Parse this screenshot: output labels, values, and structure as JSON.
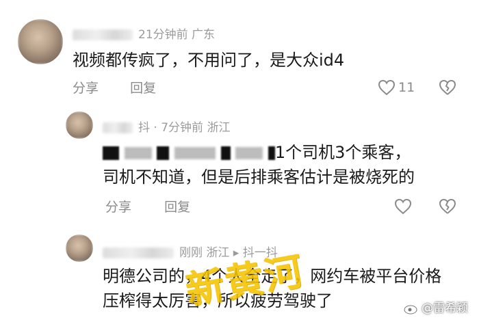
{
  "comments": [
    {
      "meta": "21分钟前 广东",
      "text": "视频都传疯了，不用问了，是大众id4",
      "reply_label": "分享",
      "reply2_label": "回复",
      "likes": "11"
    },
    {
      "meta_prefix": "抖 · ",
      "meta": "7分钟前 浙江",
      "line1_tail": "1个司机3个乘客，",
      "line2": "司机不知道，但是后排乘客估计是被烧死的",
      "reply_label": "分享",
      "reply2_label": "回复"
    },
    {
      "meta": "刚刚 浙江 ▸ 抖一抖",
      "line1": "明德公司的，4个人全走了，网约车被平台价格",
      "line2": "压榨得太厉害，所以疲劳驾驶了"
    }
  ],
  "watermark": "新黄河",
  "credit": "@雷希颖"
}
